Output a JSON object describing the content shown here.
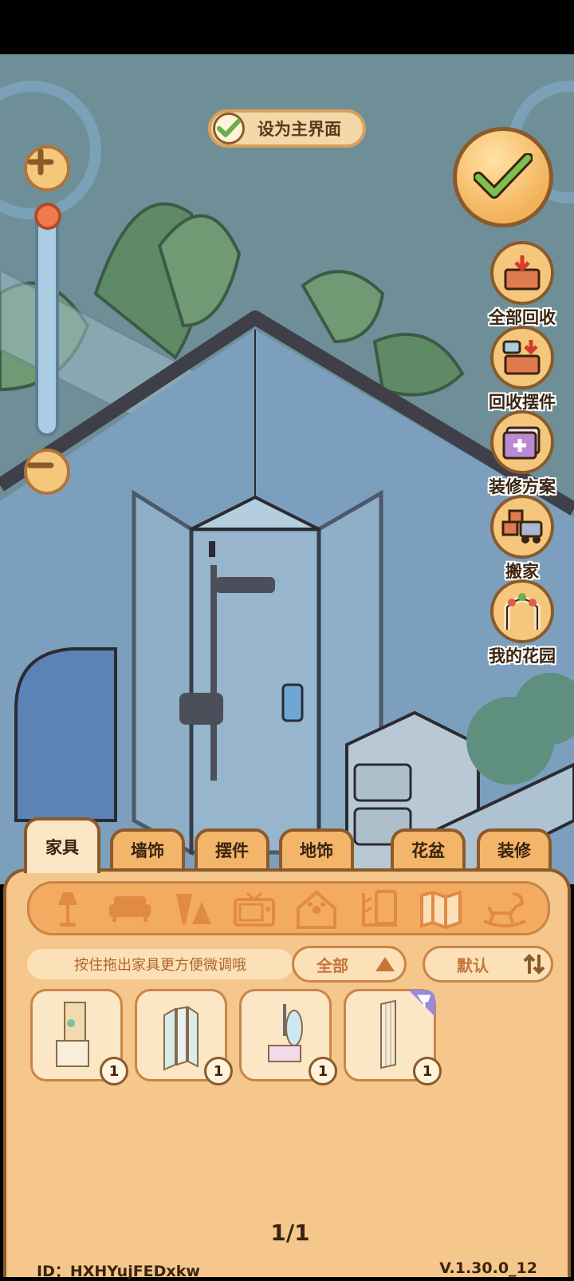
{
  "topbar": {
    "set_home_label": "设为主界面"
  },
  "side_actions": [
    {
      "label": "全部回收",
      "icon": "recycle-all-icon"
    },
    {
      "label": "回收摆件",
      "icon": "recycle-decor-icon"
    },
    {
      "label": "装修方案",
      "icon": "decor-plan-icon"
    },
    {
      "label": "搬家",
      "icon": "moving-truck-icon"
    },
    {
      "label": "我的花园",
      "icon": "garden-arch-icon"
    }
  ],
  "tabs": [
    {
      "label": "家具",
      "active": true
    },
    {
      "label": "墙饰",
      "active": false
    },
    {
      "label": "摆件",
      "active": false
    },
    {
      "label": "地饰",
      "active": false
    },
    {
      "label": "花盆",
      "active": false
    },
    {
      "label": "装修",
      "active": false
    }
  ],
  "categories": [
    "lamp-icon",
    "sofa-icon",
    "table-icon",
    "tv-icon",
    "pet-house-icon",
    "shelf-icon",
    "map-icon",
    "rocking-horse-icon"
  ],
  "hint": "按住拖出家具更方便微调哦",
  "filter": {
    "scope": "全部",
    "sort": "默认"
  },
  "items": [
    {
      "name": "bath-cabinet",
      "count": "1"
    },
    {
      "name": "glass-screen",
      "count": "1"
    },
    {
      "name": "vanity-mirror",
      "count": "1"
    },
    {
      "name": "curtain",
      "count": "1",
      "tag": "brush-tag-icon"
    }
  ],
  "pagination": "1/1",
  "footer": {
    "id": "ID：HXHYujFEDxkw",
    "version": "V.1.30.0_12"
  },
  "colors": {
    "panel": "#f6c78c",
    "tab_active": "#fbe6c6",
    "accent": "#f3b56a",
    "outline": "#8a5a2a"
  }
}
